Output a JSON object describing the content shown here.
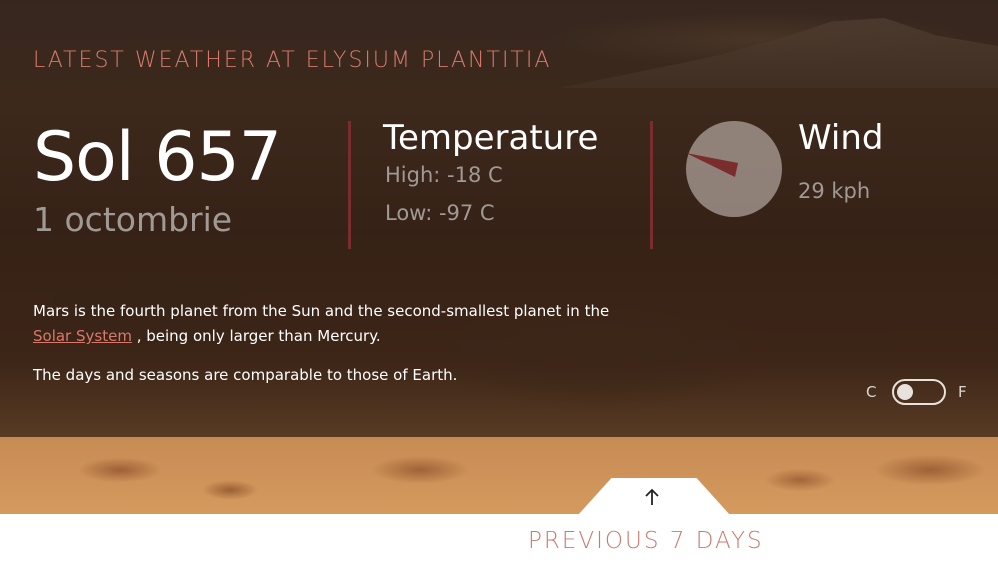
{
  "header": {
    "title": "LATEST WEATHER AT ELYSIUM PLANTITIA"
  },
  "sol": {
    "label": "Sol 657",
    "date": "1 octombrie"
  },
  "temperature": {
    "title": "Temperature",
    "high": "High: -18 C",
    "low": "Low: -97 C"
  },
  "wind": {
    "title": "Wind",
    "speed": "29 kph",
    "direction_icon": "compass-needle"
  },
  "description": {
    "line1_before": "Mars is the fourth planet from the Sun and the second-smallest planet in the",
    "link_text": "Solar System",
    "line1_after": ", being only larger than Mercury.",
    "line2": "The days and seasons are comparable to those of Earth."
  },
  "units": {
    "celsius": "C",
    "fahrenheit": "F",
    "selected": "C"
  },
  "footer": {
    "previous_label": "PREVIOUS 7 DAYS",
    "arrow_icon": "arrow-up-icon"
  },
  "colors": {
    "accent": "#d9796e",
    "divider": "#7a2d2d",
    "needle": "#7a2d2d"
  }
}
